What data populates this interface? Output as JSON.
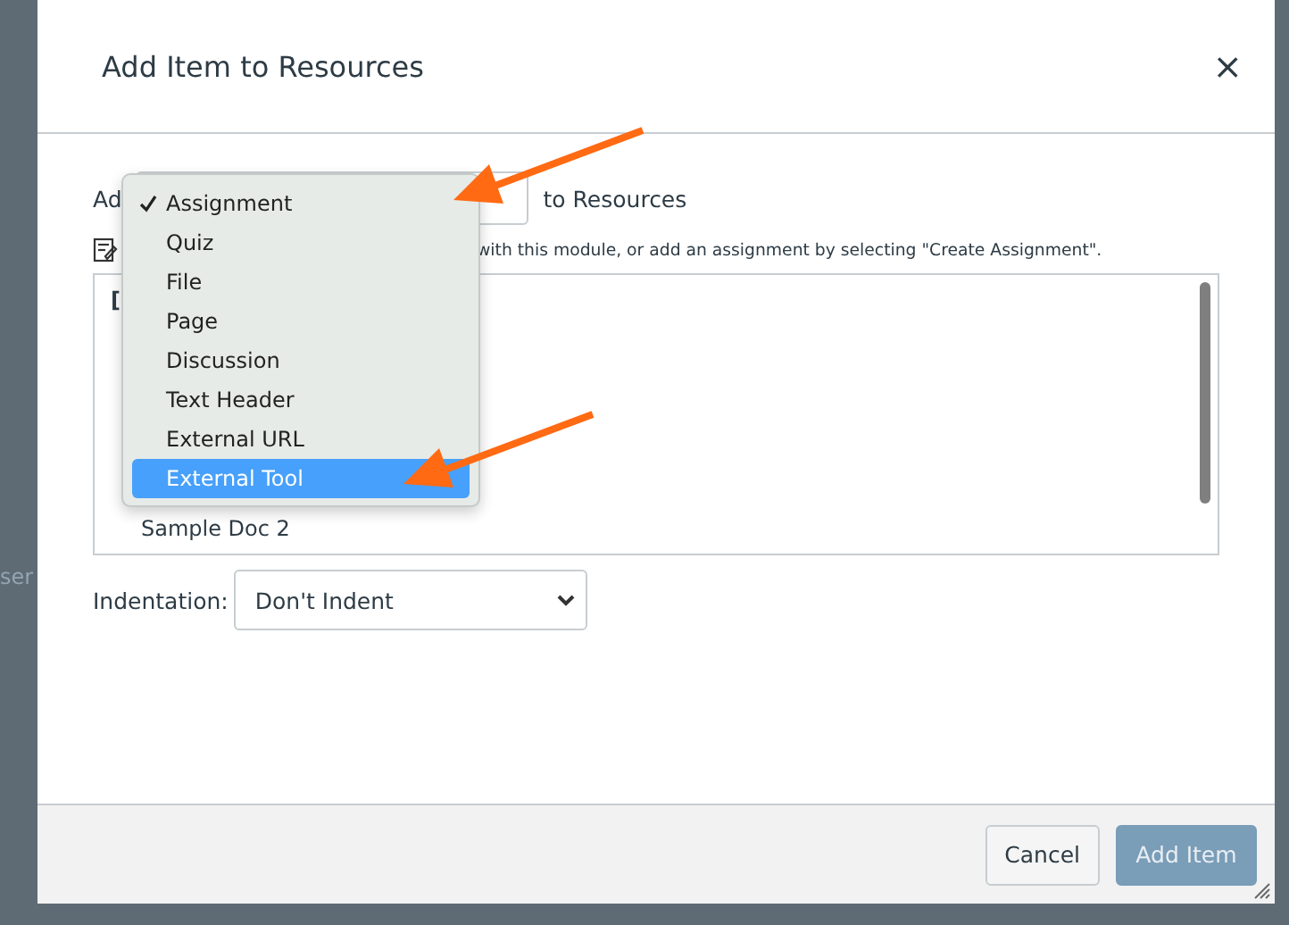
{
  "backdrop": {
    "texts": [
      "ser"
    ]
  },
  "dialog": {
    "title": "Add Item to Resources",
    "close": "×"
  },
  "add_row": {
    "label_start": "Ad",
    "label_end": "to Resources"
  },
  "hint": "with this module, or add an assignment by selecting \"Create Assignment\".",
  "item_list": [
    {
      "kind": "group",
      "text": "["
    },
    {
      "kind": "item",
      "text": "Sample Doc 2"
    }
  ],
  "type_menu": [
    {
      "label": "Assignment",
      "checked": true,
      "selected": false
    },
    {
      "label": "Quiz",
      "checked": false,
      "selected": false
    },
    {
      "label": "File",
      "checked": false,
      "selected": false
    },
    {
      "label": "Page",
      "checked": false,
      "selected": false
    },
    {
      "label": "Discussion",
      "checked": false,
      "selected": false
    },
    {
      "label": "Text Header",
      "checked": false,
      "selected": false
    },
    {
      "label": "External URL",
      "checked": false,
      "selected": false
    },
    {
      "label": "External Tool",
      "checked": false,
      "selected": true
    }
  ],
  "indentation": {
    "label": "Indentation:",
    "value": "Don't Indent"
  },
  "buttons": {
    "cancel": "Cancel",
    "add": "Add Item",
    "add_disabled": true
  }
}
